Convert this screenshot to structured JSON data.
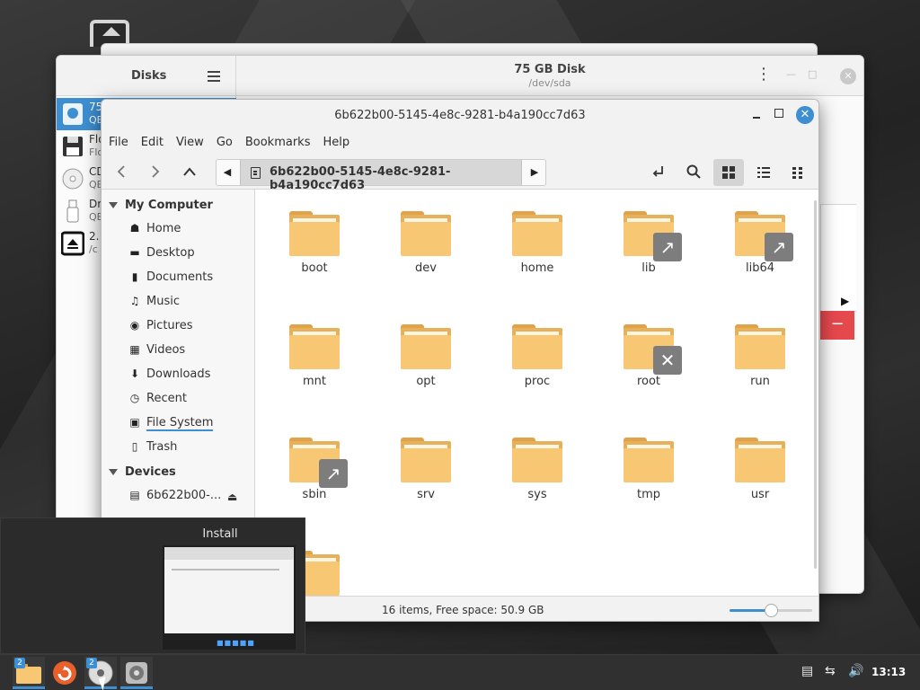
{
  "disks": {
    "title": "Disks",
    "disk_name": "75 GB Disk",
    "disk_path": "/dev/sda",
    "remove_label": "−",
    "items": [
      {
        "t1": "75",
        "t2": "QE"
      },
      {
        "t1": "Flo",
        "t2": "Flo"
      },
      {
        "t1": "CD",
        "t2": "QE"
      },
      {
        "t1": "Dr",
        "t2": "QE"
      },
      {
        "t1": "2.",
        "t2": "/c"
      }
    ]
  },
  "nemo": {
    "title": "6b622b00-5145-4e8c-9281-b4a190cc7d63",
    "menu": [
      "File",
      "Edit",
      "View",
      "Go",
      "Bookmarks",
      "Help"
    ],
    "path_segment": "6b622b00-5145-4e8c-9281-b4a190cc7d63",
    "sidebar": {
      "my_computer": "My Computer",
      "places": [
        {
          "label": "Home",
          "icon": "home-icon"
        },
        {
          "label": "Desktop",
          "icon": "desktop-icon"
        },
        {
          "label": "Documents",
          "icon": "documents-icon"
        },
        {
          "label": "Music",
          "icon": "music-icon"
        },
        {
          "label": "Pictures",
          "icon": "camera-icon"
        },
        {
          "label": "Videos",
          "icon": "film-icon"
        },
        {
          "label": "Downloads",
          "icon": "download-icon"
        },
        {
          "label": "Recent",
          "icon": "clock-icon"
        },
        {
          "label": "File System",
          "icon": "filesystem-icon"
        },
        {
          "label": "Trash",
          "icon": "trash-icon"
        }
      ],
      "devices": "Devices",
      "device_items": [
        {
          "label": "6b622b00-..."
        }
      ]
    },
    "files": [
      {
        "name": "boot",
        "emblem": ""
      },
      {
        "name": "dev",
        "emblem": ""
      },
      {
        "name": "home",
        "emblem": ""
      },
      {
        "name": "lib",
        "emblem": "symlink-icon"
      },
      {
        "name": "lib64",
        "emblem": "symlink-icon"
      },
      {
        "name": "mnt",
        "emblem": ""
      },
      {
        "name": "opt",
        "emblem": ""
      },
      {
        "name": "proc",
        "emblem": ""
      },
      {
        "name": "root",
        "emblem": "no-access-icon"
      },
      {
        "name": "run",
        "emblem": ""
      },
      {
        "name": "sbin",
        "emblem": "symlink-icon"
      },
      {
        "name": "srv",
        "emblem": ""
      },
      {
        "name": "sys",
        "emblem": ""
      },
      {
        "name": "tmp",
        "emblem": ""
      },
      {
        "name": "usr",
        "emblem": ""
      },
      {
        "name": "",
        "emblem": ""
      }
    ],
    "status": "16 items, Free space: 50.9 GB",
    "zoom_fraction": 0.5
  },
  "popup": {
    "title": "Install"
  },
  "taskbar": {
    "apps": [
      {
        "name": "files",
        "badge": "2"
      },
      {
        "name": "installer",
        "badge": ""
      },
      {
        "name": "disc",
        "badge": "2"
      },
      {
        "name": "disks",
        "badge": ""
      }
    ],
    "clock": "13:13"
  },
  "colors": {
    "accent": "#3d8fd1",
    "folder": "#f7c774",
    "danger": "#e5484d"
  }
}
